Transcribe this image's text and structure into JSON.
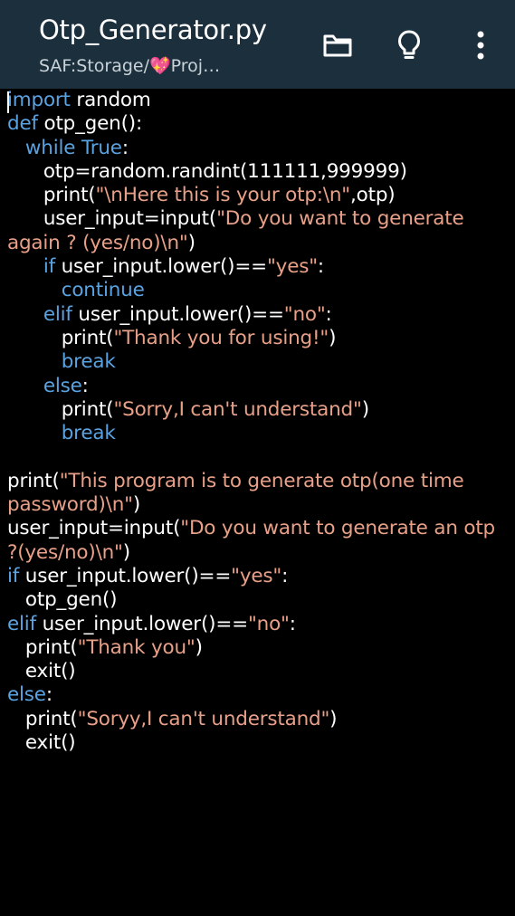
{
  "appbar": {
    "title": "Otp_Generator.py",
    "path": "SAF:Storage/💖Proj…",
    "icons": [
      "folder-icon",
      "lightbulb-icon",
      "more-vert-icon"
    ]
  },
  "colors": {
    "appbar_bg": "#1c2f3c",
    "editor_bg": "#000000",
    "keyword": "#5aa2e0",
    "string": "#e8a088",
    "plain": "#ffffff"
  },
  "code": {
    "lines": [
      [
        {
          "t": "kw",
          "v": "import"
        },
        {
          "t": "pl",
          "v": " random"
        }
      ],
      [
        {
          "t": "kw",
          "v": "def"
        },
        {
          "t": "pl",
          "v": " otp_gen():"
        }
      ],
      [
        {
          "t": "pl",
          "v": "   "
        },
        {
          "t": "kw",
          "v": "while"
        },
        {
          "t": "pl",
          "v": " "
        },
        {
          "t": "kw",
          "v": "True"
        },
        {
          "t": "pl",
          "v": ":"
        }
      ],
      [
        {
          "t": "pl",
          "v": "      otp=random.randint(111111,999999)"
        }
      ],
      [
        {
          "t": "pl",
          "v": "      print("
        },
        {
          "t": "str",
          "v": "\"\\nHere this is your otp:\\n\""
        },
        {
          "t": "pl",
          "v": ",otp)"
        }
      ],
      [
        {
          "t": "pl",
          "v": "      user_input=input("
        },
        {
          "t": "str",
          "v": "\"Do you want to generate again ? (yes/no)\\n\""
        },
        {
          "t": "pl",
          "v": ")"
        }
      ],
      [
        {
          "t": "pl",
          "v": "      "
        },
        {
          "t": "kw",
          "v": "if"
        },
        {
          "t": "pl",
          "v": " user_input.lower()=="
        },
        {
          "t": "str",
          "v": "\"yes\""
        },
        {
          "t": "pl",
          "v": ":"
        }
      ],
      [
        {
          "t": "pl",
          "v": "         "
        },
        {
          "t": "kw",
          "v": "continue"
        }
      ],
      [
        {
          "t": "pl",
          "v": "      "
        },
        {
          "t": "kw",
          "v": "elif"
        },
        {
          "t": "pl",
          "v": " user_input.lower()=="
        },
        {
          "t": "str",
          "v": "\"no\""
        },
        {
          "t": "pl",
          "v": ":"
        }
      ],
      [
        {
          "t": "pl",
          "v": "         print("
        },
        {
          "t": "str",
          "v": "\"Thank you for using!\""
        },
        {
          "t": "pl",
          "v": ")"
        }
      ],
      [
        {
          "t": "pl",
          "v": "         "
        },
        {
          "t": "kw",
          "v": "break"
        }
      ],
      [
        {
          "t": "pl",
          "v": "      "
        },
        {
          "t": "kw",
          "v": "else"
        },
        {
          "t": "pl",
          "v": ":"
        }
      ],
      [
        {
          "t": "pl",
          "v": "         print("
        },
        {
          "t": "str",
          "v": "\"Sorry,I can't understand\""
        },
        {
          "t": "pl",
          "v": ")"
        }
      ],
      [
        {
          "t": "pl",
          "v": "         "
        },
        {
          "t": "kw",
          "v": "break"
        }
      ],
      [],
      [
        {
          "t": "pl",
          "v": "print("
        },
        {
          "t": "str",
          "v": "\"This program is to generate otp(one time password)\\n\""
        },
        {
          "t": "pl",
          "v": ")"
        }
      ],
      [
        {
          "t": "pl",
          "v": "user_input=input("
        },
        {
          "t": "str",
          "v": "\"Do you want to generate an otp ?(yes/no)\\n\""
        },
        {
          "t": "pl",
          "v": ")"
        }
      ],
      [
        {
          "t": "kw",
          "v": "if"
        },
        {
          "t": "pl",
          "v": " user_input.lower()=="
        },
        {
          "t": "str",
          "v": "\"yes\""
        },
        {
          "t": "pl",
          "v": ":"
        }
      ],
      [
        {
          "t": "pl",
          "v": "   otp_gen()"
        }
      ],
      [
        {
          "t": "kw",
          "v": "elif"
        },
        {
          "t": "pl",
          "v": " user_input.lower()=="
        },
        {
          "t": "str",
          "v": "\"no\""
        },
        {
          "t": "pl",
          "v": ":"
        }
      ],
      [
        {
          "t": "pl",
          "v": "   print("
        },
        {
          "t": "str",
          "v": "\"Thank you\""
        },
        {
          "t": "pl",
          "v": ")"
        }
      ],
      [
        {
          "t": "pl",
          "v": "   exit()"
        }
      ],
      [
        {
          "t": "kw",
          "v": "else"
        },
        {
          "t": "pl",
          "v": ":"
        }
      ],
      [
        {
          "t": "pl",
          "v": "   print("
        },
        {
          "t": "str",
          "v": "\"Soryy,I can't understand\""
        },
        {
          "t": "pl",
          "v": ")"
        }
      ],
      [
        {
          "t": "pl",
          "v": "   exit()"
        }
      ]
    ]
  }
}
